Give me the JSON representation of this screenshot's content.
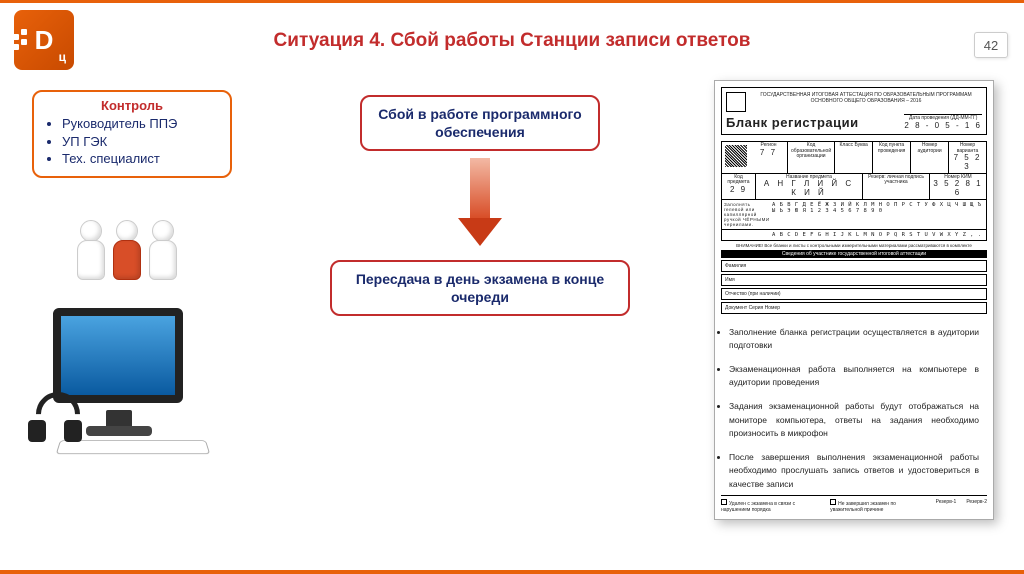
{
  "page_number": "42",
  "title": "Ситуация 4. Сбой работы Станции записи ответов",
  "logo": {
    "main": "D",
    "sub": "ц"
  },
  "control": {
    "title": "Контроль",
    "items": [
      "Руководитель ППЭ",
      "УП ГЭК",
      "Тех. специалист"
    ]
  },
  "box_failure": "Сбой в работе программного обеспечения",
  "box_retake": "Пересдача в день экзамена в конце очереди",
  "form": {
    "org_line": "ГОСУДАРСТВЕННАЯ ИТОГОВАЯ АТТЕСТАЦИЯ \nПО ОБРАЗОВАТЕЛЬНЫМ ПРОГРАММАМ ОСНОВНОГО ОБЩЕГО ОБРАЗОВАНИЯ – 2016",
    "title": "Бланк регистрации",
    "date_lbl": "Дата проведения (ДД-ММ-ГГ)",
    "date_val": "2 8 - 0 5 - 1 6",
    "row1": [
      {
        "lbl": "Регион",
        "val": "7 7"
      },
      {
        "lbl": "Код образовательной организации",
        "val": ""
      },
      {
        "lbl": "Класс  Буква",
        "val": ""
      },
      {
        "lbl": "Код пункта проведения",
        "val": ""
      },
      {
        "lbl": "Номер аудитории",
        "val": ""
      },
      {
        "lbl": "Номер варианта",
        "val": "7 5 2 3"
      }
    ],
    "row2": [
      {
        "lbl": "Код предмета",
        "val": "2 9"
      },
      {
        "lbl": "Название предмета",
        "val": "А Н Г Л И Й С К И Й"
      },
      {
        "lbl": "Резерв: личная подпись участника",
        "val": ""
      },
      {
        "lbl": "Номер КИМ",
        "val": "3 5 2 8 1 6"
      }
    ],
    "alpha_lbl": "Заполнять гелевой или капиллярной ручкой ЧЁРНЫМИ чернилами.",
    "alpha1": "А Б В Г Д Е Ё Ж З И Й К Л М Н О П Р С Т У Ф Х Ц Ч Ш Щ Ъ Ы Ь Э Ю Я 1 2 3 4 5 6 7 8 9 0",
    "alpha2": "A B C D E F G H I J K L M N O P Q R S T U V W X Y Z , .",
    "note": "ВНИМАНИЕ! Все бланки и листы с контрольными измерительными материалами рассматриваются в комплекте",
    "section1": "Сведения об участнике государственной итоговой аттестации",
    "fields": [
      "Фамилия",
      "Имя",
      "Отчество (при наличии)",
      "Документ   Серия                               Номер"
    ],
    "bullets": [
      "Заполнение бланка регистрации осуществляется в аудитории подготовки",
      "Экзаменационная работа выполняется на компьютере в аудитории проведения",
      "Задания экзаменационной работы будут отображаться на мониторе компьютера, ответы на задания необходимо произносить в микрофон",
      "После завершения выполнения экзаменационной работы необходимо прослушать запись ответов и удостовериться в качестве записи"
    ],
    "footer": [
      "Удален с экзамена в связи с нарушением порядка",
      "Не завершил экзамен по уважительной причине",
      "Резерв-1",
      "Резерв-2"
    ]
  }
}
